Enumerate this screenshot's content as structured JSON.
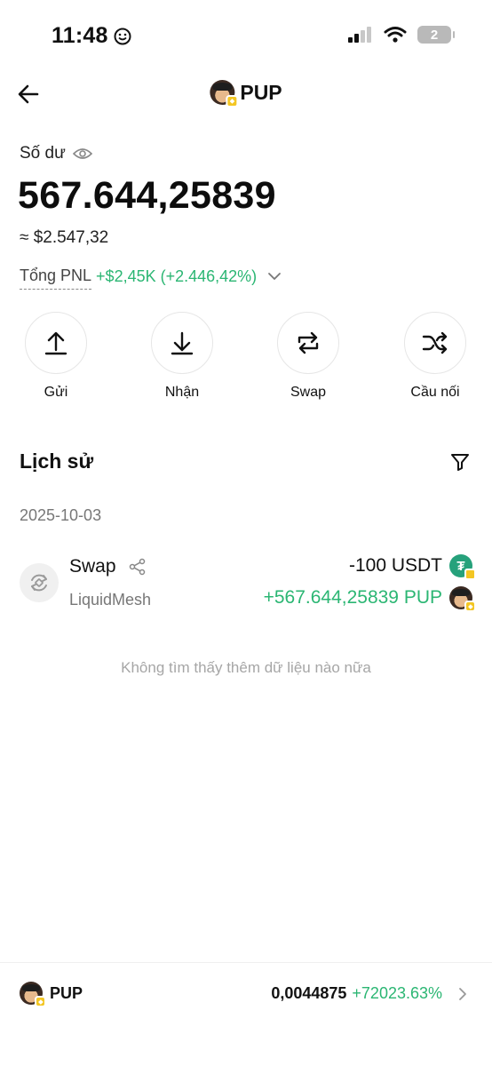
{
  "status_bar": {
    "time": "11:48",
    "battery": "2"
  },
  "header": {
    "title": "PUP"
  },
  "balance": {
    "label": "Số dư",
    "amount": "567.644,25839",
    "usd": "≈ $2.547,32",
    "pnl_label": "Tổng PNL",
    "pnl_value": "+$2,45K (+2.446,42%)"
  },
  "actions": [
    {
      "label": "Gửi",
      "icon": "upload-icon"
    },
    {
      "label": "Nhận",
      "icon": "download-icon"
    },
    {
      "label": "Swap",
      "icon": "swap-icon"
    },
    {
      "label": "Cầu nối",
      "icon": "shuffle-icon"
    }
  ],
  "history": {
    "title": "Lịch sử",
    "date": "2025-10-03",
    "transaction": {
      "type": "Swap",
      "provider": "LiquidMesh",
      "out_amount": "-100 USDT",
      "in_amount": "+567.644,25839 PUP",
      "out_token_glyph": "₮"
    },
    "empty_text": "Không tìm thấy thêm dữ liệu nào nữa"
  },
  "bottom": {
    "token": "PUP",
    "price": "0,0044875",
    "change": "+72023.63%"
  },
  "colors": {
    "positive": "#2bb673",
    "usdt": "#26a17b",
    "badge": "#f3c623"
  }
}
